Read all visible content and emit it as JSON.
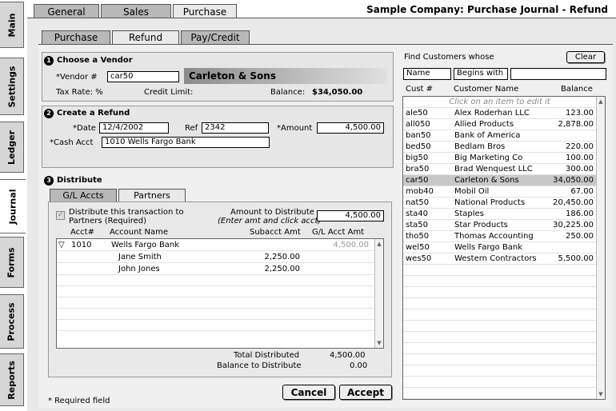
{
  "title": "Sample Company: Purchase Journal - Refund",
  "side_tabs": [
    "Main",
    "Settings",
    "Ledger",
    "Journal",
    "Forms",
    "Process",
    "Reports"
  ],
  "top_tabs": [
    "General",
    "Sales",
    "Purchase"
  ],
  "sub_tabs": [
    "Purchase",
    "Refund",
    "Pay/Credit"
  ],
  "vendor": {
    "section_num": "1",
    "section_title": "Choose a Vendor",
    "vendor_label": "*Vendor #",
    "vendor_value": "car50",
    "vendor_name": "Carleton & Sons",
    "tax_label": "Tax Rate: %",
    "credit_label": "Credit Limit:",
    "balance_label": "Balance:",
    "balance_value": "$34,050.00"
  },
  "refund": {
    "section_num": "2",
    "section_title": "Create a Refund",
    "date_label": "*Date",
    "date_value": "12/4/2002",
    "ref_label": "Ref",
    "ref_value": "2342",
    "amount_label": "*Amount",
    "amount_value": "4,500.00",
    "cash_label": "*Cash Acct",
    "cash_value": "1010 Wells Fargo Bank"
  },
  "distribute": {
    "section_num": "3",
    "section_title": "Distribute",
    "tabs": [
      "G/L Accts",
      "Partners"
    ],
    "checkbox_label_1": "Distribute this transaction to",
    "checkbox_label_2": "Partners (Required)",
    "amount_to_dist_label": "Amount to Distribute",
    "amount_hint": "(Enter amt and click acct)",
    "amount_to_dist_value": "4,500.00",
    "columns": [
      "Acct#",
      "Account Name",
      "Subacct Amt",
      "G/L Acct Amt"
    ],
    "rows": [
      {
        "acct": "1010",
        "name": "Wells Fargo Bank",
        "sub": "",
        "gl": "4,500.00",
        "expand": "▽"
      },
      {
        "acct": "",
        "name": "Jane Smith",
        "sub": "2,250.00",
        "gl": "",
        "expand": ""
      },
      {
        "acct": "",
        "name": "John Jones",
        "sub": "2,250.00",
        "gl": "",
        "expand": ""
      }
    ],
    "total_label": "Total Distributed",
    "total_value": "4,500.00",
    "balance_label": "Balance to Distribute",
    "balance_value": "0.00"
  },
  "required_note": "* Required field",
  "cancel_label": "Cancel",
  "accept_label": "Accept",
  "finder": {
    "title": "Find Customers whose",
    "clear_label": "Clear",
    "field_value": "Name",
    "match_value": "Begins with",
    "search_value": "",
    "columns": [
      "Cust #",
      "Customer Name",
      "Balance"
    ],
    "hint": "Click on an item to edit it",
    "rows": [
      {
        "id": "ale50",
        "name": "Alex Roderhan LLC",
        "bal": "123.00"
      },
      {
        "id": "all050",
        "name": "Allied Products",
        "bal": "2,878.00"
      },
      {
        "id": "ban50",
        "name": "Bank of America",
        "bal": ""
      },
      {
        "id": "bed50",
        "name": "Bedlam Bros",
        "bal": "220.00"
      },
      {
        "id": "big50",
        "name": "Big Marketing Co",
        "bal": "100.00"
      },
      {
        "id": "bra50",
        "name": "Brad Wenquest LLC",
        "bal": "300.00"
      },
      {
        "id": "car50",
        "name": "Carleton & Sons",
        "bal": "34,050.00"
      },
      {
        "id": "mob40",
        "name": "Mobil Oil",
        "bal": "67.00"
      },
      {
        "id": "nat50",
        "name": "National Products",
        "bal": "20,450.00"
      },
      {
        "id": "sta40",
        "name": "Staples",
        "bal": "186.00"
      },
      {
        "id": "sta50",
        "name": "Star Products",
        "bal": "30,225.00"
      },
      {
        "id": "tho50",
        "name": "Thomas Accounting",
        "bal": "250.00"
      },
      {
        "id": "wel50",
        "name": "Wells Fargo Bank",
        "bal": ""
      },
      {
        "id": "wes50",
        "name": "Western Contractors",
        "bal": "5,500.00"
      }
    ],
    "selected_id": "car50"
  }
}
